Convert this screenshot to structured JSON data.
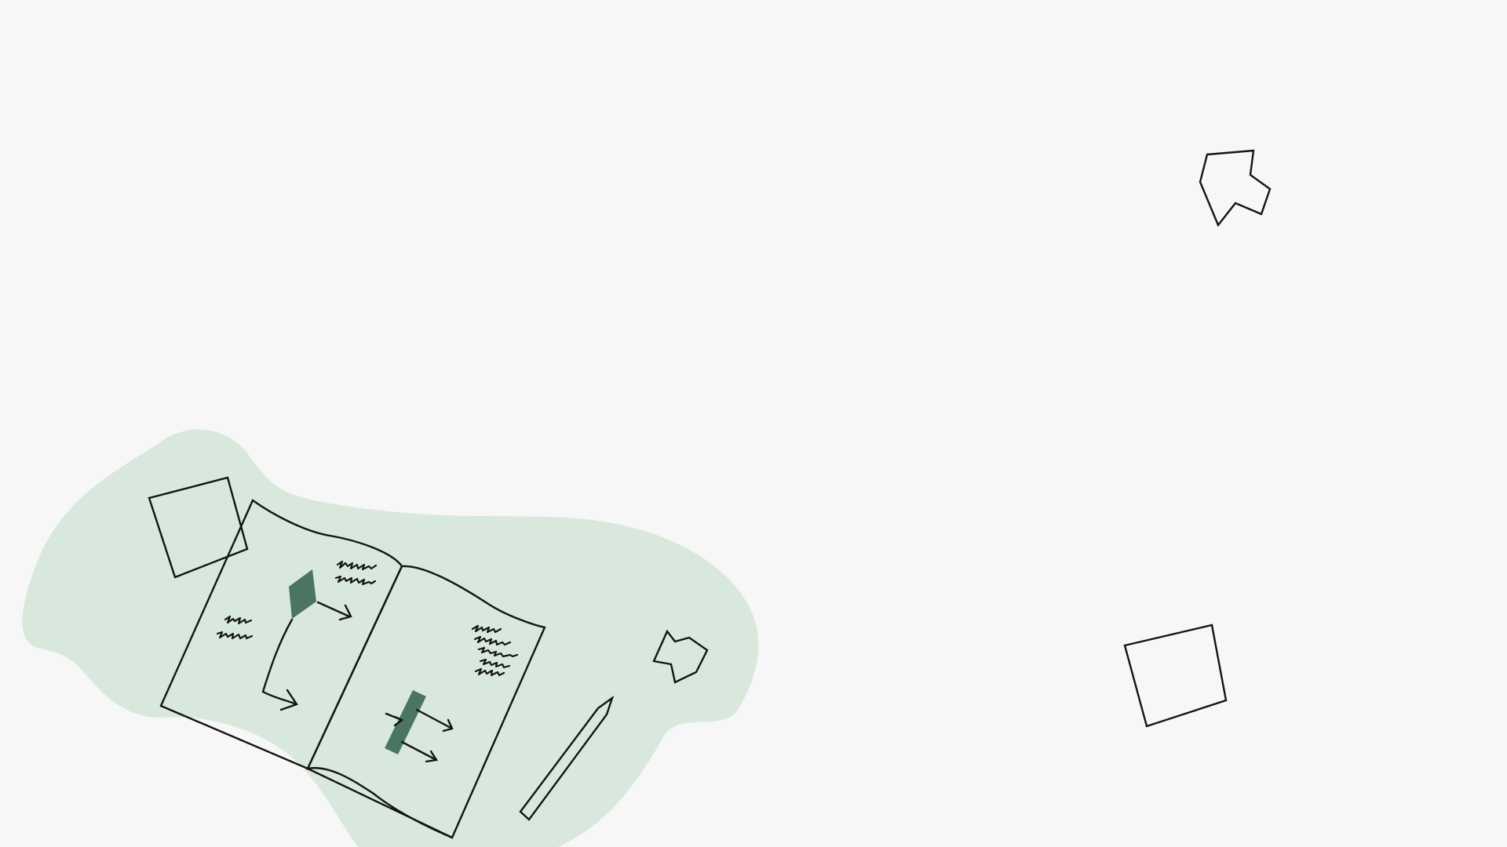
{
  "colors": {
    "background": "#f7f7f7",
    "blob": "#d8e8dc",
    "paper": "#f7f7f7",
    "ink": "#141414",
    "accent_dark": "#4a7561",
    "accent_light": "#d8e8dc"
  },
  "illustration": {
    "subject": "open-notebook-with-pencil-and-floating-shapes",
    "icons": [
      "notebook-icon",
      "pencil-icon",
      "square-icon",
      "arrow-shape-icon"
    ]
  }
}
